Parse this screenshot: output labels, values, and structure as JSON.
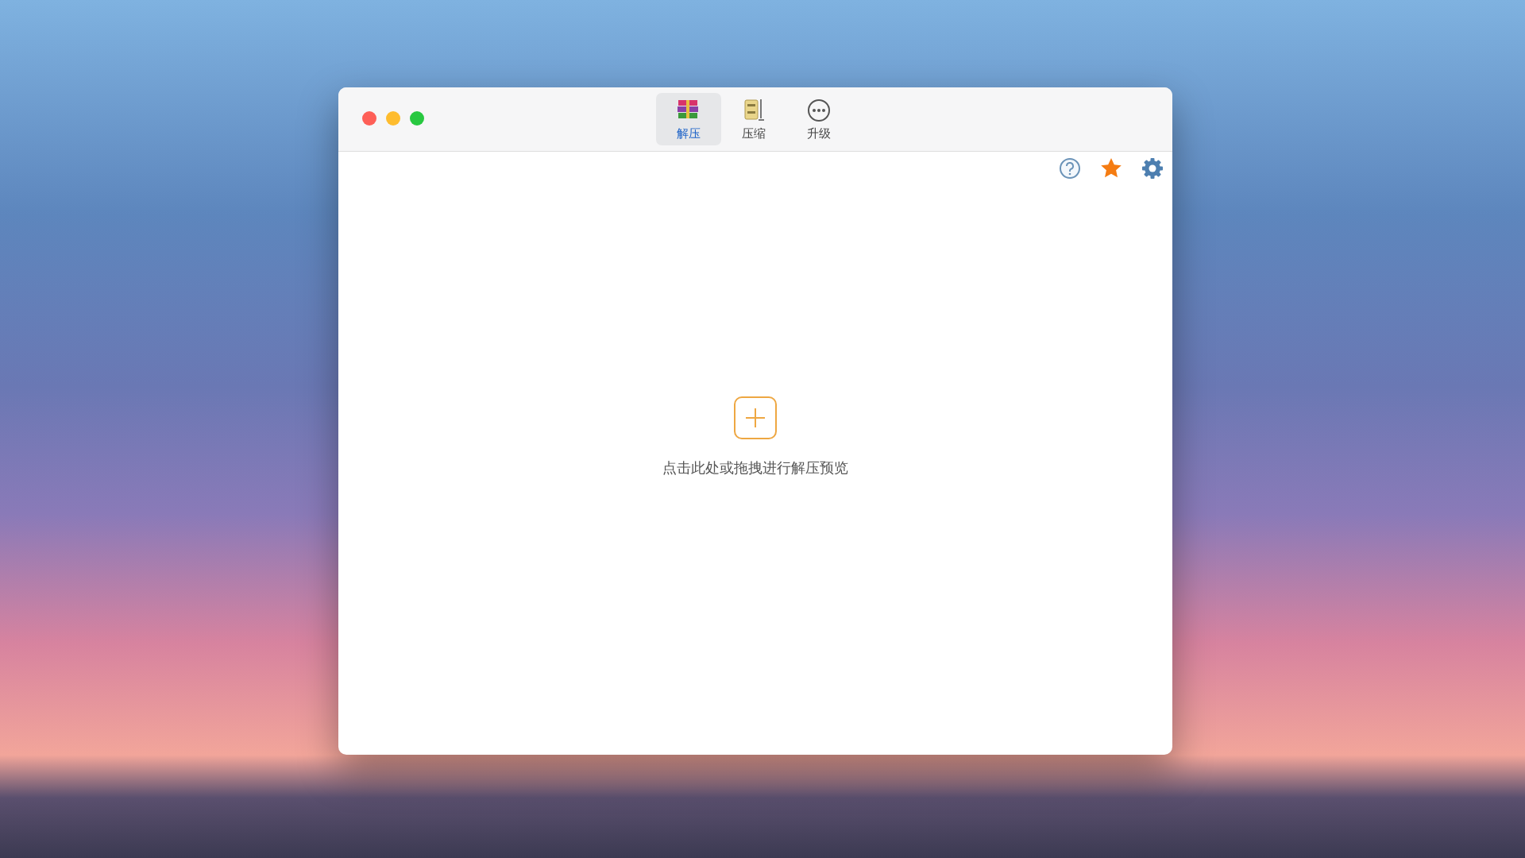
{
  "tabs": [
    {
      "label": "解压",
      "kind": "archive",
      "selected": true
    },
    {
      "label": "压缩",
      "kind": "cabinet",
      "selected": false
    },
    {
      "label": "升级",
      "kind": "more",
      "selected": false
    }
  ],
  "drop_area": {
    "hint": "点击此处或拖拽进行解压预览"
  }
}
